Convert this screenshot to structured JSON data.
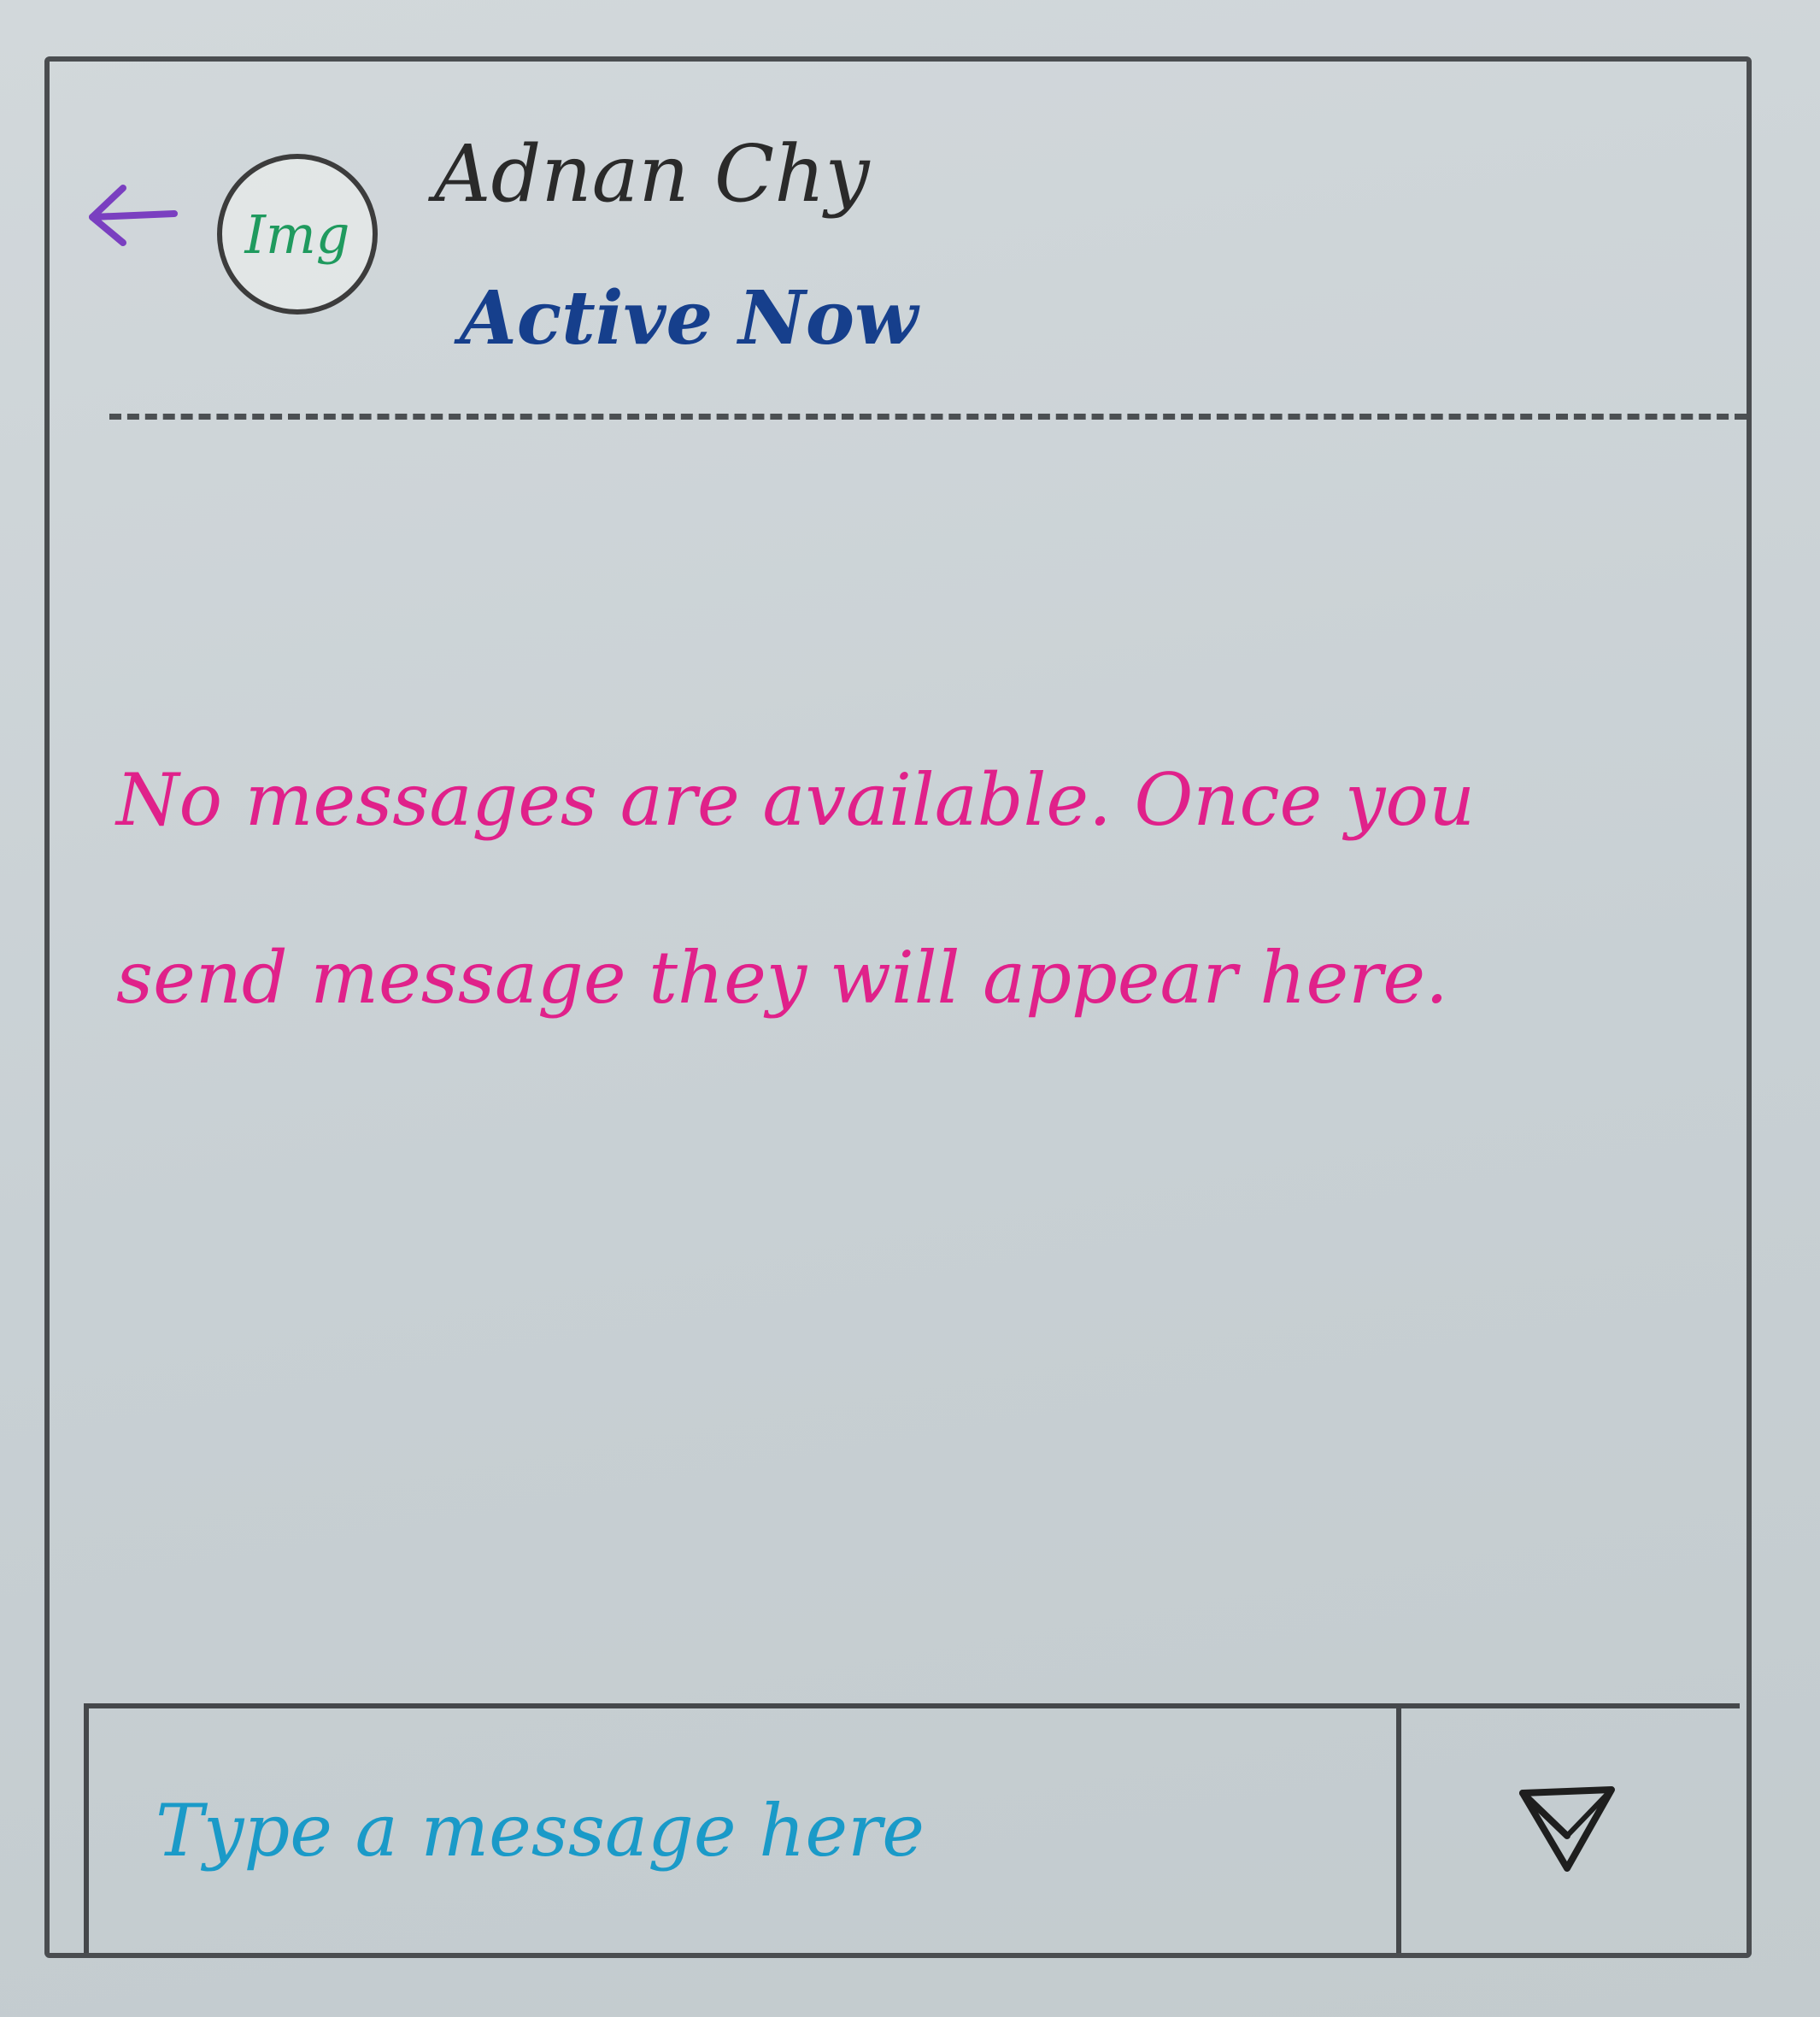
{
  "header": {
    "contact_name": "Adnan Chy",
    "status": "Active Now",
    "avatar_text": "Img",
    "back_icon": "back-arrow-icon",
    "colors": {
      "back_arrow": "#7a3fc0",
      "avatar_text": "#1f9a5e",
      "status": "#163f8c"
    }
  },
  "messages": {
    "empty_text": "No messages are available. Once you send message they will appear here.",
    "color": "#e0218a"
  },
  "composer": {
    "placeholder": "Type a message here",
    "send_icon": "send-icon",
    "placeholder_color": "#1a9ac8"
  }
}
